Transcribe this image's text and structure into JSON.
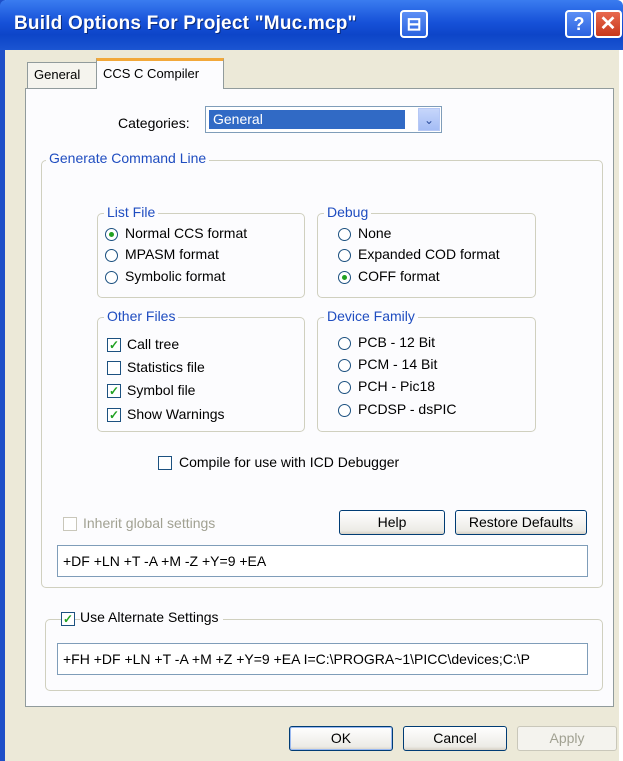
{
  "window": {
    "title": "Build Options For Project \"Muc.mcp\""
  },
  "titlebar": {
    "context_glyph": "⊟",
    "help_glyph": "?",
    "close_glyph": "✕"
  },
  "tabs": [
    {
      "label": "General"
    },
    {
      "label": "CCS C Compiler"
    }
  ],
  "categories": {
    "label": "Categories:",
    "value": "General",
    "arrow_glyph": "⌄"
  },
  "generate": {
    "title": "Generate Command Line",
    "list_file": {
      "title": "List File",
      "options": [
        "Normal CCS format",
        "MPASM format",
        "Symbolic format"
      ],
      "selected": 0
    },
    "debug": {
      "title": "Debug",
      "options": [
        "None",
        "Expanded COD format",
        "COFF format"
      ],
      "selected": 2
    },
    "other_files": {
      "title": "Other Files",
      "items": [
        {
          "label": "Call tree",
          "checked": true
        },
        {
          "label": "Statistics file",
          "checked": false
        },
        {
          "label": "Symbol file",
          "checked": true
        },
        {
          "label": "Show Warnings",
          "checked": true
        }
      ]
    },
    "device_family": {
      "title": "Device Family",
      "options": [
        "PCB - 12 Bit",
        "PCM - 14 Bit",
        "PCH - Pic18",
        "PCDSP - dsPIC"
      ]
    },
    "icd": {
      "label": "Compile for use with ICD Debugger",
      "checked": false
    },
    "inherit": {
      "label": "Inherit global settings",
      "checked": false
    },
    "help_button": "Help",
    "restore_button": "Restore Defaults",
    "command_line": "+DF +LN +T -A +M -Z +Y=9 +EA"
  },
  "alternate": {
    "label": "Use Alternate Settings",
    "checked": true,
    "command_line": "+FH +DF +LN +T -A +M +Z +Y=9 +EA I=C:\\PROGRA~1\\PICC\\devices;C:\\P"
  },
  "footer": {
    "ok": "OK",
    "cancel": "Cancel",
    "apply": "Apply"
  },
  "check_glyph": "✓"
}
